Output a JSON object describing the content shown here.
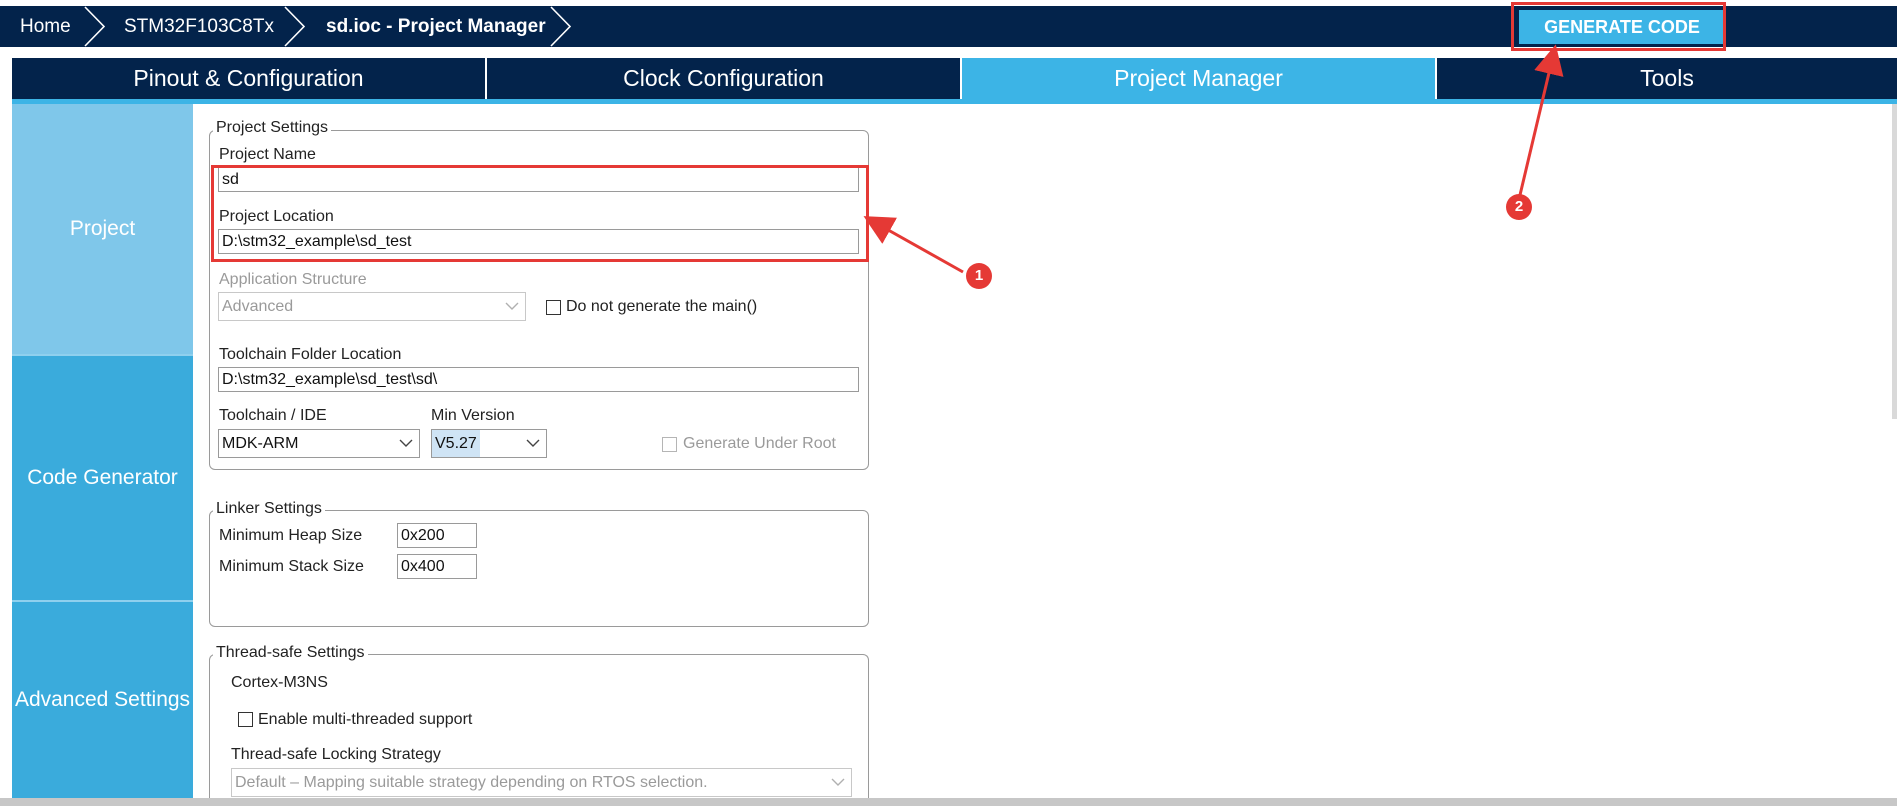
{
  "breadcrumb": {
    "home": "Home",
    "device": "STM32F103C8Tx",
    "project": "sd.ioc - Project Manager"
  },
  "toolbar": {
    "generate_label": "GENERATE CODE"
  },
  "tabs": [
    {
      "label": "Pinout & Configuration",
      "active": false
    },
    {
      "label": "Clock Configuration",
      "active": false
    },
    {
      "label": "Project Manager",
      "active": true
    },
    {
      "label": "Tools",
      "active": false
    }
  ],
  "sidebar": {
    "items": [
      {
        "label": "Project"
      },
      {
        "label": "Code Generator"
      },
      {
        "label": "Advanced Settings"
      }
    ]
  },
  "project_settings": {
    "title": "Project Settings",
    "project_name_label": "Project Name",
    "project_name": "sd",
    "project_location_label": "Project Location",
    "project_location": "D:\\stm32_example\\sd_test",
    "app_structure_label": "Application Structure",
    "app_structure": "Advanced",
    "no_main_label": "Do not generate the main()",
    "toolchain_folder_label": "Toolchain Folder Location",
    "toolchain_folder": "D:\\stm32_example\\sd_test\\sd\\",
    "toolchain_ide_label": "Toolchain / IDE",
    "toolchain_ide": "MDK-ARM",
    "min_version_label": "Min Version",
    "min_version": "V5.27",
    "generate_under_root_label": "Generate Under Root"
  },
  "linker_settings": {
    "title": "Linker Settings",
    "heap_label": "Minimum Heap Size",
    "heap_value": "0x200",
    "stack_label": "Minimum Stack Size",
    "stack_value": "0x400"
  },
  "thread_settings": {
    "title": "Thread-safe Settings",
    "core": "Cortex-M3NS",
    "multi_thread_label": "Enable multi-threaded support",
    "locking_label": "Thread-safe Locking Strategy",
    "locking_value": "Default  –  Mapping suitable strategy depending on RTOS selection."
  },
  "annotations": {
    "badge1": "1",
    "badge2": "2"
  },
  "colors": {
    "navy": "#03234b",
    "accent": "#3cb4e6",
    "annotation_red": "#e53935"
  }
}
